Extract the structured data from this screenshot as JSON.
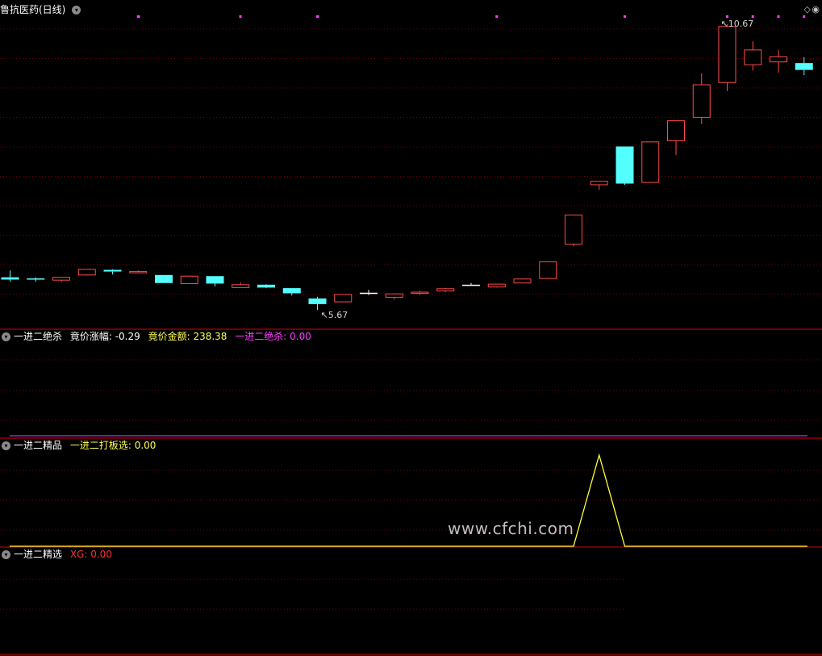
{
  "main_panel": {
    "title": "鲁抗医药(日线)",
    "high_label": "10.67",
    "low_label": "5.67",
    "high_value": 10.67,
    "low_value": 5.67,
    "colors": {
      "up": "#ff4a4a",
      "down": "#54ffff",
      "flat": "#ffffff",
      "marker": "#ff3cff",
      "grid": "#8b0000"
    }
  },
  "panel2": {
    "title": "一进二绝杀",
    "items": [
      {
        "label": "竟价涨幅: ",
        "value": "-0.29",
        "color": "#ffffff"
      },
      {
        "label": "竟价金额: ",
        "value": "238.38",
        "color": "#ffff54"
      },
      {
        "label": "一进二绝杀: ",
        "value": "0.00",
        "color": "#ff3cff"
      }
    ]
  },
  "panel3": {
    "title": "一进二精品",
    "items": [
      {
        "label": "一进二打板选: ",
        "value": "0.00",
        "color": "#ffff54"
      }
    ]
  },
  "panel4": {
    "title": "一进二精选",
    "items": [
      {
        "label": "XG: ",
        "value": "0.00",
        "color": "#ff3030"
      }
    ]
  },
  "watermark": "www.cfchi.com",
  "chart_data": {
    "type": "candlestick",
    "candles": [
      {
        "o": 6.24,
        "h": 6.36,
        "l": 6.16,
        "c": 6.2
      },
      {
        "o": 6.22,
        "h": 6.24,
        "l": 6.16,
        "c": 6.2
      },
      {
        "o": 6.19,
        "h": 6.25,
        "l": 6.16,
        "c": 6.24
      },
      {
        "o": 6.28,
        "h": 6.38,
        "l": 6.27,
        "c": 6.38
      },
      {
        "o": 6.37,
        "h": 6.38,
        "l": 6.29,
        "c": 6.34
      },
      {
        "o": 6.33,
        "h": 6.36,
        "l": 6.31,
        "c": 6.34
      },
      {
        "o": 6.28,
        "h": 6.28,
        "l": 6.14,
        "c": 6.14
      },
      {
        "o": 6.13,
        "h": 6.27,
        "l": 6.12,
        "c": 6.26
      },
      {
        "o": 6.26,
        "h": 6.26,
        "l": 6.08,
        "c": 6.13
      },
      {
        "o": 6.06,
        "h": 6.15,
        "l": 6.06,
        "c": 6.11
      },
      {
        "o": 6.11,
        "h": 6.12,
        "l": 6.05,
        "c": 6.06
      },
      {
        "o": 6.05,
        "h": 6.05,
        "l": 5.92,
        "c": 5.96
      },
      {
        "o": 5.87,
        "h": 5.9,
        "l": 5.67,
        "c": 5.77
      },
      {
        "o": 5.81,
        "h": 5.94,
        "l": 5.81,
        "c": 5.94
      },
      {
        "o": 5.97,
        "h": 6.02,
        "l": 5.93,
        "c": 5.97
      },
      {
        "o": 5.89,
        "h": 5.96,
        "l": 5.85,
        "c": 5.95
      },
      {
        "o": 5.96,
        "h": 6.0,
        "l": 5.93,
        "c": 5.98
      },
      {
        "o": 6.0,
        "h": 6.05,
        "l": 5.98,
        "c": 6.04
      },
      {
        "o": 6.11,
        "h": 6.14,
        "l": 6.09,
        "c": 6.11
      },
      {
        "o": 6.07,
        "h": 6.12,
        "l": 6.06,
        "c": 6.12
      },
      {
        "o": 6.14,
        "h": 6.21,
        "l": 6.13,
        "c": 6.21
      },
      {
        "o": 6.22,
        "h": 6.51,
        "l": 6.21,
        "c": 6.51
      },
      {
        "o": 6.82,
        "h": 7.33,
        "l": 6.78,
        "c": 7.33
      },
      {
        "o": 7.86,
        "h": 7.93,
        "l": 7.77,
        "c": 7.92
      },
      {
        "o": 8.53,
        "h": 8.53,
        "l": 7.86,
        "c": 7.88
      },
      {
        "o": 7.9,
        "h": 8.61,
        "l": 7.9,
        "c": 8.61
      },
      {
        "o": 8.63,
        "h": 8.9,
        "l": 8.38,
        "c": 8.98
      },
      {
        "o": 9.04,
        "h": 9.81,
        "l": 8.92,
        "c": 9.61
      },
      {
        "o": 9.65,
        "h": 10.67,
        "l": 9.5,
        "c": 10.63
      },
      {
        "o": 9.96,
        "h": 10.37,
        "l": 9.86,
        "c": 10.22
      },
      {
        "o": 10.01,
        "h": 10.22,
        "l": 9.82,
        "c": 10.1
      },
      {
        "o": 9.99,
        "h": 10.09,
        "l": 9.78,
        "c": 9.87
      }
    ],
    "signal_markers": [
      5,
      12,
      19,
      24,
      28,
      29,
      30,
      31,
      32,
      33,
      34,
      35,
      36
    ],
    "panel3_line": {
      "name": "一进二打板选",
      "values": [
        0,
        0,
        0,
        0,
        0,
        0,
        0,
        0,
        0,
        0,
        0,
        0,
        0,
        0,
        0,
        0,
        0,
        0,
        0,
        0,
        0,
        0,
        0,
        1,
        0,
        0,
        0,
        0,
        0,
        0,
        0,
        0
      ]
    }
  }
}
